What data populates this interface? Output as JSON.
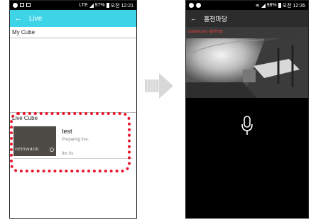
{
  "left_phone": {
    "status_bar": {
      "time": "오전 12:21",
      "battery": "97%",
      "network": "LTE"
    },
    "app_bar": {
      "title": "Live"
    },
    "sections": {
      "my_cube": "My Cube",
      "live_cube": "Live Cube"
    },
    "live_items": [
      {
        "title": "test",
        "status": "Preparing live.",
        "duration": "9m 0s",
        "thumbnail_text": "nemwaon"
      }
    ]
  },
  "right_phone": {
    "status_bar": {
      "time": "오전 12:35",
      "battery": "98%"
    },
    "app_bar": {
      "title": "홍천마당"
    },
    "video_overlay": "Live(9m 0s) - 홍천마당",
    "mic_icon": "microphone-icon"
  },
  "colors": {
    "app_bar_left": "#3ed4e8",
    "app_bar_right": "#2c2c2c",
    "highlight": "#e8142b",
    "live_overlay_text": "#ff3b3b"
  }
}
